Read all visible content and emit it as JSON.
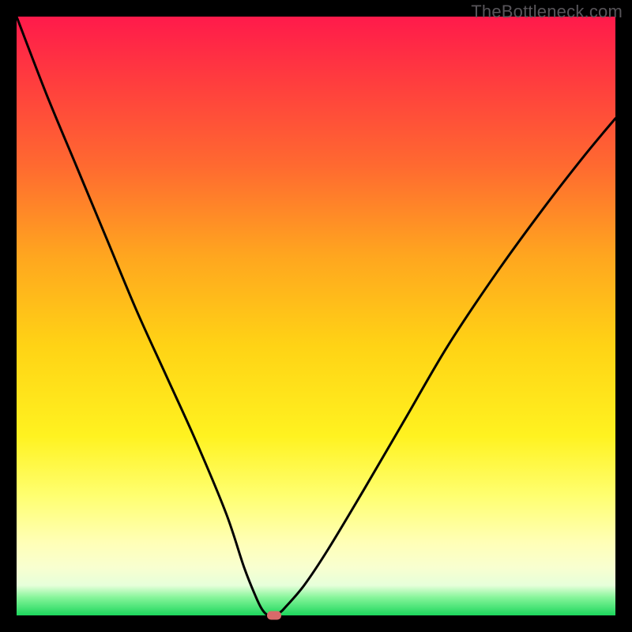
{
  "watermark": "TheBottleneck.com",
  "chart_data": {
    "type": "line",
    "title": "",
    "xlabel": "",
    "ylabel": "",
    "xlim": [
      0,
      100
    ],
    "ylim": [
      0,
      100
    ],
    "grid": false,
    "legend": false,
    "series": [
      {
        "name": "curve",
        "color": "#000000",
        "x": [
          0,
          5,
          10,
          15,
          20,
          25,
          30,
          35,
          38,
          40,
          41,
          42,
          43,
          44,
          45,
          48,
          52,
          58,
          65,
          72,
          80,
          88,
          95,
          100
        ],
        "y": [
          100,
          87,
          75,
          63,
          51,
          40,
          29,
          17,
          8,
          3,
          1,
          0,
          0,
          0.5,
          1.5,
          5,
          11,
          21,
          33,
          45,
          57,
          68,
          77,
          83
        ]
      }
    ],
    "marker": {
      "x": 43,
      "y": 0,
      "color": "#d96a6a"
    },
    "background_gradient": {
      "top": "#ff1a4b",
      "mid": "#fff220",
      "bottom": "#1cd65c"
    }
  }
}
